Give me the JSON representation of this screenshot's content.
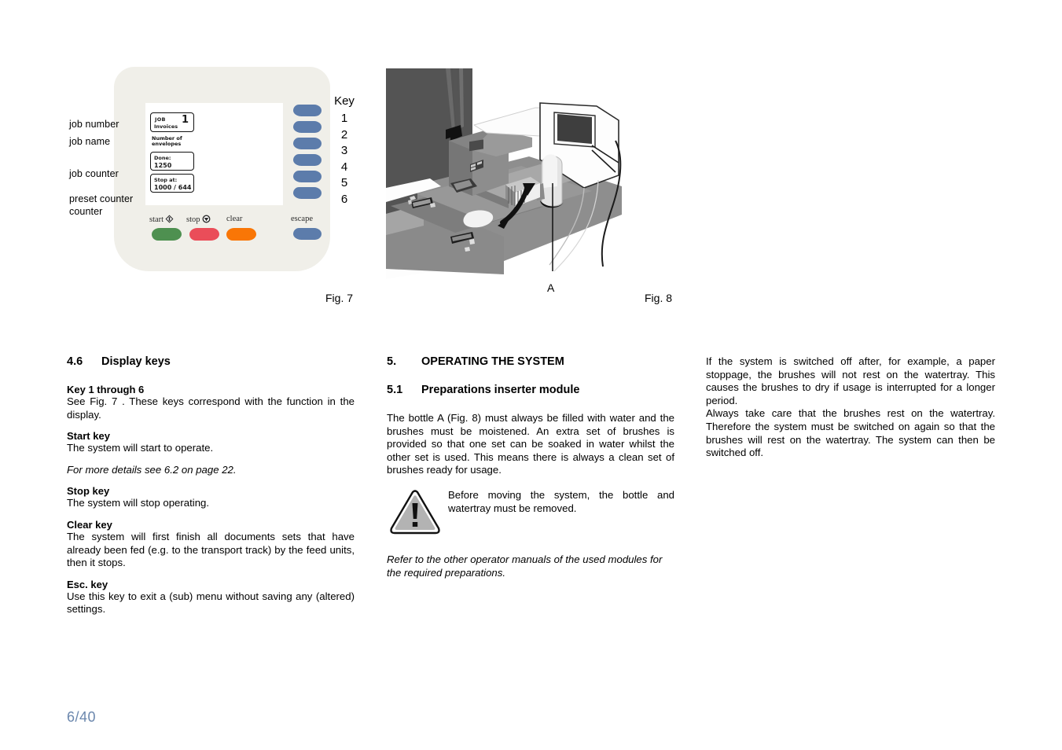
{
  "page": {
    "number": "6/40"
  },
  "figures": {
    "fig7": {
      "caption": "Fig. 7",
      "annotations": {
        "job_number": "job number",
        "job_name": "job name",
        "job_counter": "job counter",
        "preset_counter": "preset counter",
        "counter": "counter"
      },
      "display": {
        "job_word": "JOB",
        "job_number_value": "1",
        "job_name_value": "Invoices",
        "envelopes_label": "Number of envelopes",
        "done_label": "Done:",
        "done_value": "1250",
        "stop_at_label": "Stop at:",
        "stop_at_value": "1000 / 644"
      },
      "buttons": {
        "start": "start",
        "stop": "stop",
        "clear": "clear",
        "escape": "escape"
      },
      "key_column": {
        "header": "Key",
        "numbers": [
          "1",
          "2",
          "3",
          "4",
          "5",
          "6"
        ]
      }
    },
    "fig8": {
      "caption": "Fig. 8",
      "callout_a": "A"
    }
  },
  "columns": {
    "left": {
      "section_number": "4.6",
      "section_title": "Display keys",
      "blocks": [
        {
          "heading": "Key 1 through 6",
          "text": "See Fig. 7 . These keys correspond with the function in the display."
        },
        {
          "heading": "Start key",
          "text": "The system will start to operate."
        },
        {
          "italic": "For more details see 6.2 on page 22."
        },
        {
          "heading": "Stop key",
          "text": "The system will stop operating."
        },
        {
          "heading": "Clear key",
          "text": "The system will first finish all documents sets that have already been fed (e.g. to the transport track) by the feed units, then it stops."
        },
        {
          "heading": "Esc. key",
          "text": "Use this key to exit a (sub) menu without saving any (altered) settings."
        }
      ]
    },
    "middle": {
      "section_number": "5.",
      "section_title": "OPERATING THE SYSTEM",
      "subsection_number": "5.1",
      "subsection_title": "Preparations inserter module",
      "paragraph": "The bottle A (Fig. 8) must always be filled with water and the brushes must be moistened. An extra set of brushes is provided so that one set can be soaked in water whilst the other set is used. This means there is always a clean set of brushes ready for usage.",
      "warning": "Before moving the system, the bottle and watertray must be removed.",
      "note_italic": "Refer to the other operator manuals of the used modules for the required preparations."
    },
    "right": {
      "paragraph1": "If the system is switched off after, for example, a paper stoppage, the brushes will not rest on the watertray. This causes the brushes to dry if usage is interrupted for a longer period.",
      "paragraph2": "Always take care that the brushes rest on the watertray. Therefore the system must be switched on again so that the brushes will rest on the watertray. The system can then be switched off."
    }
  },
  "colors": {
    "panel_body": "#f0efe9",
    "key_button": "#5c7cab",
    "start_button": "#4e9050",
    "stop_button": "#ea4d59",
    "clear_button": "#f97606",
    "page_number": "#6b87ad"
  }
}
